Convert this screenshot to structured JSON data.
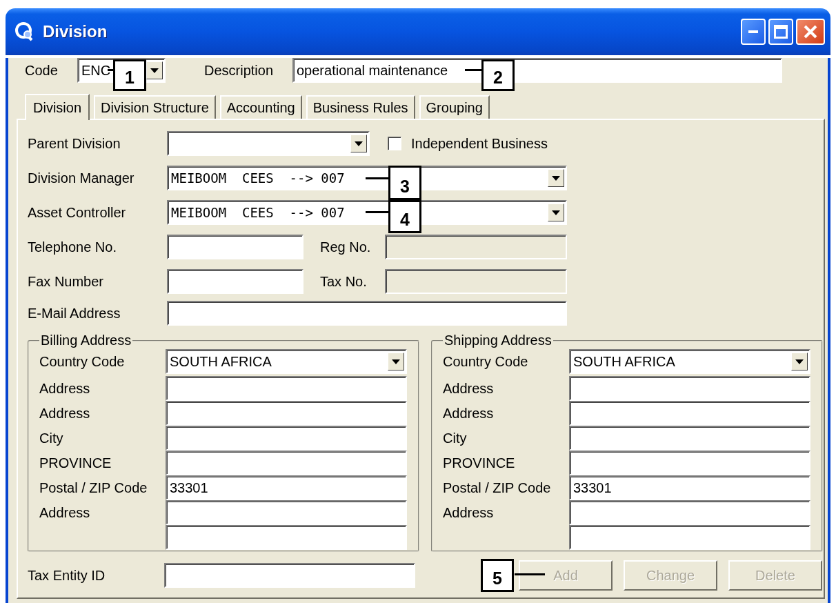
{
  "window": {
    "title": "Division"
  },
  "header": {
    "code": {
      "label": "Code",
      "value": "ENC",
      "callout": "1"
    },
    "description": {
      "label": "Description",
      "value": "operational maintenance",
      "callout": "2"
    }
  },
  "tabs": [
    {
      "label": "Division",
      "selected": true
    },
    {
      "label": "Division Structure",
      "selected": false
    },
    {
      "label": "Accounting",
      "selected": false
    },
    {
      "label": "Business Rules",
      "selected": false
    },
    {
      "label": "Grouping",
      "selected": false
    }
  ],
  "parent_division": {
    "label": "Parent Division"
  },
  "independent_business": {
    "label": "Independent Business",
    "checked": false
  },
  "division_manager": {
    "label": "Division Manager",
    "value": "MEIBOOM  CEES  --> 007",
    "callout": "3"
  },
  "asset_controller": {
    "label": "Asset Controller",
    "value": "MEIBOOM  CEES  --> 007",
    "callout": "4"
  },
  "telephone": {
    "label": "Telephone No."
  },
  "reg_no": {
    "label": "Reg No.",
    "disabled": true
  },
  "fax": {
    "label": "Fax Number"
  },
  "tax_no": {
    "label": "Tax No.",
    "disabled": true
  },
  "email": {
    "label": "E-Mail Address"
  },
  "addresses": [
    {
      "title": "Billing Address",
      "rows": [
        {
          "kind": "combo",
          "label": "Country Code",
          "value": "SOUTH AFRICA"
        },
        {
          "kind": "text",
          "label": "Address"
        },
        {
          "kind": "text",
          "label": "Address"
        },
        {
          "kind": "text",
          "label": "City"
        },
        {
          "kind": "text",
          "label": "PROVINCE"
        },
        {
          "kind": "text",
          "label": "Postal / ZIP Code",
          "value": "33301"
        },
        {
          "kind": "text",
          "label": "Address"
        },
        {
          "kind": "text"
        }
      ]
    },
    {
      "title": "Shipping Address",
      "rows": [
        {
          "kind": "combo",
          "label": "Country Code",
          "value": "SOUTH AFRICA"
        },
        {
          "kind": "text",
          "label": "Address"
        },
        {
          "kind": "text",
          "label": "Address"
        },
        {
          "kind": "text",
          "label": "City"
        },
        {
          "kind": "text",
          "label": "PROVINCE"
        },
        {
          "kind": "text",
          "label": "Postal / ZIP Code",
          "value": "33301"
        },
        {
          "kind": "text",
          "label": "Address"
        },
        {
          "kind": "text"
        }
      ]
    }
  ],
  "tax_entity": {
    "label": "Tax Entity ID"
  },
  "buttons": [
    {
      "label": "Add",
      "disabled": true,
      "callout": "5"
    },
    {
      "label": "Change",
      "disabled": true
    },
    {
      "label": "Delete",
      "disabled": true
    }
  ]
}
